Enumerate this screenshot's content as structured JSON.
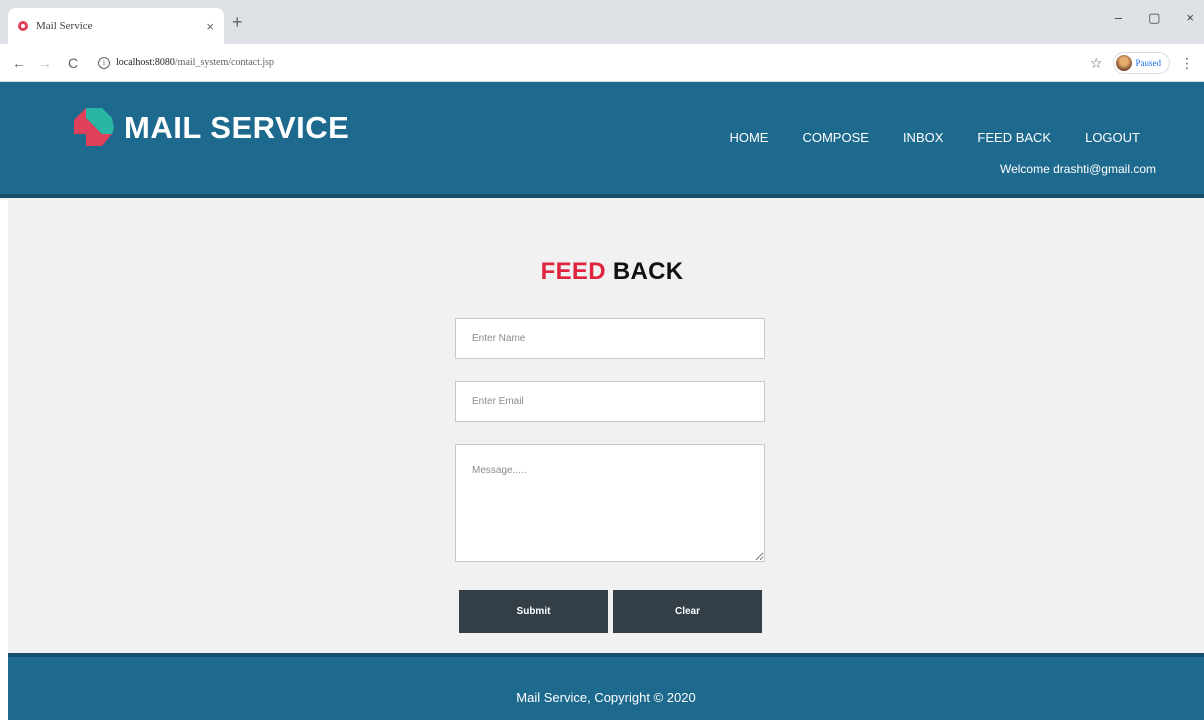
{
  "browser": {
    "tab_title": "Mail Service",
    "tab_close": "×",
    "new_tab": "+",
    "url_host": "localhost:8080",
    "url_path": "/mail_system/contact.jsp",
    "profile_label": "Paused",
    "window_controls": {
      "minimize": "–",
      "maximize": "▢",
      "close": "×"
    }
  },
  "header": {
    "logo_text": "MAIL SERVICE",
    "nav": [
      "HOME",
      "COMPOSE",
      "INBOX",
      "FEED BACK",
      "LOGOUT"
    ],
    "welcome": "Welcome drashti@gmail.com",
    "colors": {
      "header_bg": "#1e6a8f",
      "logo_red": "#e0405a",
      "logo_teal": "#2ab5a5"
    }
  },
  "main": {
    "title_red": "FEED",
    "title_black": " BACK",
    "name_placeholder": "Enter Name",
    "email_placeholder": "Enter Email",
    "message_placeholder": "Message.....",
    "submit_label": "Submit",
    "clear_label": "Clear",
    "accent_color": "#e0243e"
  },
  "footer": {
    "text": "Mail Service, Copyright © 2020"
  }
}
